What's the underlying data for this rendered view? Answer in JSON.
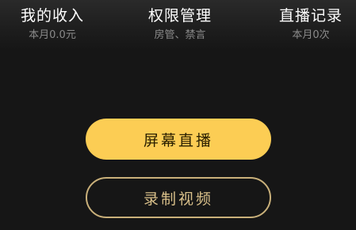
{
  "stats": {
    "income": {
      "title": "我的收入",
      "subtitle": "本月0.0元"
    },
    "permissions": {
      "title": "权限管理",
      "subtitle": "房管、禁言"
    },
    "records": {
      "title": "直播记录",
      "subtitle": "本月0次"
    }
  },
  "actions": {
    "screen_live_label": "屏幕直播",
    "record_video_label": "录制视频"
  },
  "colors": {
    "background": "#161616",
    "primary_button": "#fccd54",
    "outline_button_border": "#c9b07a",
    "subtitle_text": "#8a8a8a"
  }
}
